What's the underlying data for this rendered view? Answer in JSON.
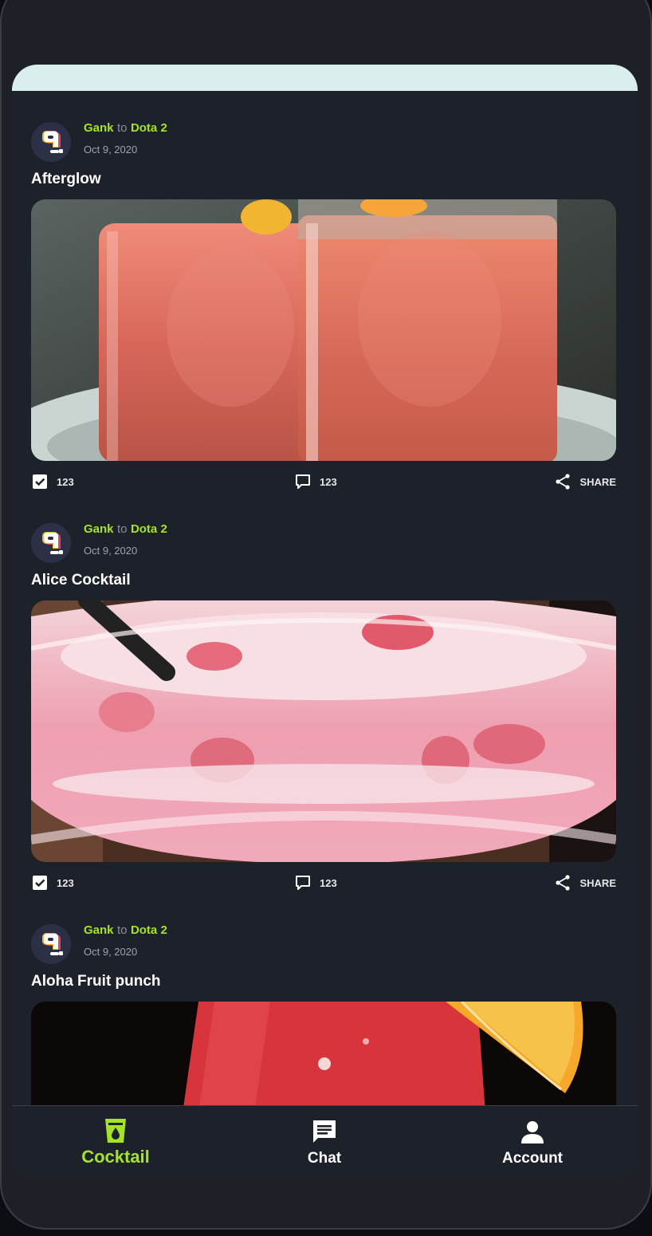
{
  "posts": [
    {
      "author": "Gank",
      "connector": "to",
      "group": "Dota 2",
      "date": "Oct 9, 2020",
      "title": "Afterglow",
      "likes": "123",
      "comments": "123",
      "share_label": "SHARE"
    },
    {
      "author": "Gank",
      "connector": "to",
      "group": "Dota 2",
      "date": "Oct 9, 2020",
      "title": "Alice Cocktail",
      "likes": "123",
      "comments": "123",
      "share_label": "SHARE"
    },
    {
      "author": "Gank",
      "connector": "to",
      "group": "Dota 2",
      "date": "Oct 9, 2020",
      "title": "Aloha Fruit punch"
    }
  ],
  "bottom_nav": {
    "items": [
      {
        "label": "Cocktail",
        "icon": "cocktail-icon",
        "active": true
      },
      {
        "label": "Chat",
        "icon": "chat-icon",
        "active": false
      },
      {
        "label": "Account",
        "icon": "account-icon",
        "active": false
      }
    ]
  },
  "colors": {
    "accent": "#a5e32b",
    "background": "#1d2129",
    "header_strip": "#d9eeed",
    "text": "#ffffff"
  }
}
